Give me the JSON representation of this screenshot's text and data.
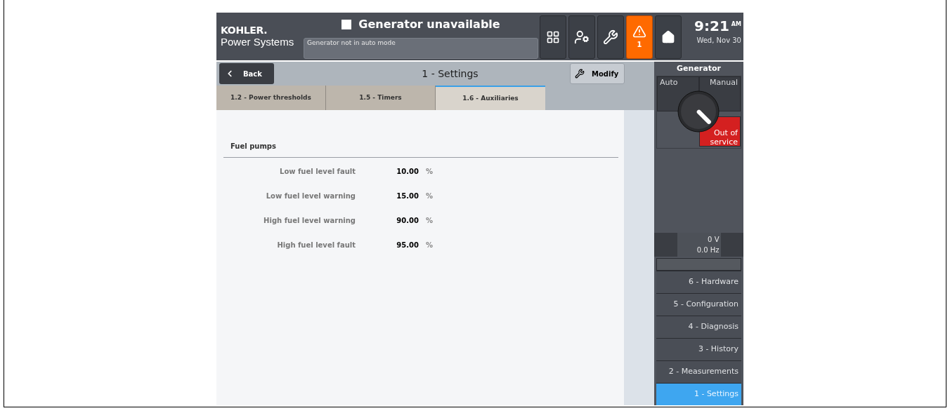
{
  "header": {
    "logo_brand": "KOHLER.",
    "logo_sub": "Power Systems",
    "status_title": "Generator unavailable",
    "status_message": "Generator not in auto mode",
    "alarm_count": "1",
    "time": "9:21",
    "time_suffix": "AM",
    "date": "Wed, Nov 30"
  },
  "toolbar": {
    "back": "Back",
    "title": "1 - Settings",
    "modify": "Modify"
  },
  "tabs": [
    {
      "label": "1.2 - Power thresholds",
      "selected": false
    },
    {
      "label": "1.5 - Timers",
      "selected": false
    },
    {
      "label": "1.6 - Auxiliaries",
      "selected": true
    }
  ],
  "section": {
    "title": "Fuel pumps",
    "rows": [
      {
        "label": "Low fuel level fault",
        "value": "10.00",
        "unit": "%"
      },
      {
        "label": "Low fuel level warning",
        "value": "15.00",
        "unit": "%"
      },
      {
        "label": "High fuel level warning",
        "value": "90.00",
        "unit": "%"
      },
      {
        "label": "High fuel level fault",
        "value": "95.00",
        "unit": "%"
      }
    ]
  },
  "generator": {
    "title": "Generator",
    "modes": [
      {
        "label": "Auto",
        "selected": false
      },
      {
        "label": "Manual",
        "selected": false
      },
      {
        "label": "Out of service",
        "selected": true
      }
    ],
    "voltage": "0 V",
    "frequency": "0.0 Hz"
  },
  "menu": [
    {
      "label": "6 - Hardware",
      "selected": false
    },
    {
      "label": "5 - Configuration",
      "selected": false
    },
    {
      "label": "4 - Diagnosis",
      "selected": false
    },
    {
      "label": "3 - History",
      "selected": false
    },
    {
      "label": "2 - Measurements",
      "selected": false
    },
    {
      "label": "1 - Settings",
      "selected": true
    }
  ]
}
